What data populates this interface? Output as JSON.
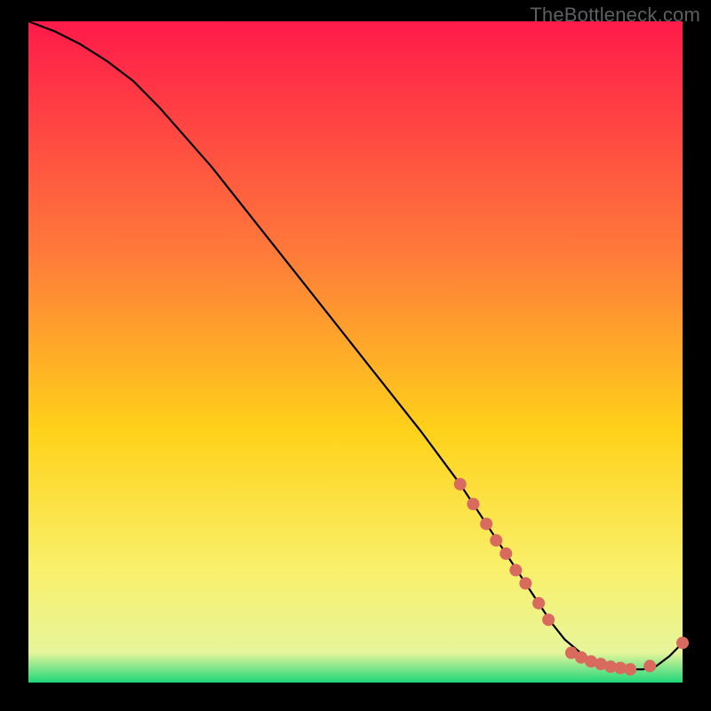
{
  "watermark": "TheBottleneck.com",
  "colors": {
    "black": "#000000",
    "line": "#000000",
    "dot": "#d86a5e",
    "grad_top": "#ff1a4a",
    "grad_mid_upper": "#ff7a3a",
    "grad_mid": "#ffd21a",
    "grad_lower": "#f9f06b",
    "grad_green": "#1fd67a"
  },
  "chart_data": {
    "type": "line",
    "title": "",
    "xlabel": "",
    "ylabel": "",
    "xlim": [
      0,
      100
    ],
    "ylim": [
      0,
      100
    ],
    "legend": false,
    "series": [
      {
        "name": "bottleneck-curve",
        "color": "#000000",
        "x": [
          0,
          4,
          8,
          12,
          16,
          20,
          28,
          36,
          44,
          52,
          60,
          66,
          70,
          74,
          78,
          80,
          82,
          85,
          88,
          91,
          94,
          96,
          98,
          100
        ],
        "y": [
          100,
          98.5,
          96.5,
          94,
          91,
          87,
          78,
          68,
          58,
          48,
          38,
          30,
          24,
          18,
          12,
          9,
          6.5,
          4,
          2.5,
          2,
          2,
          2.5,
          4,
          6
        ]
      }
    ],
    "highlight_dots": {
      "color": "#d86a5e",
      "points": [
        {
          "x": 66,
          "y": 30
        },
        {
          "x": 68,
          "y": 27
        },
        {
          "x": 70,
          "y": 24
        },
        {
          "x": 71.5,
          "y": 21.5
        },
        {
          "x": 73,
          "y": 19.5
        },
        {
          "x": 74.5,
          "y": 17
        },
        {
          "x": 76,
          "y": 15
        },
        {
          "x": 78,
          "y": 12
        },
        {
          "x": 79.5,
          "y": 9.5
        },
        {
          "x": 83,
          "y": 4.5
        },
        {
          "x": 84.5,
          "y": 3.8
        },
        {
          "x": 86,
          "y": 3.2
        },
        {
          "x": 87.5,
          "y": 2.8
        },
        {
          "x": 89,
          "y": 2.4
        },
        {
          "x": 90.5,
          "y": 2.2
        },
        {
          "x": 92,
          "y": 2
        },
        {
          "x": 95,
          "y": 2.5
        },
        {
          "x": 100,
          "y": 6
        }
      ]
    }
  }
}
